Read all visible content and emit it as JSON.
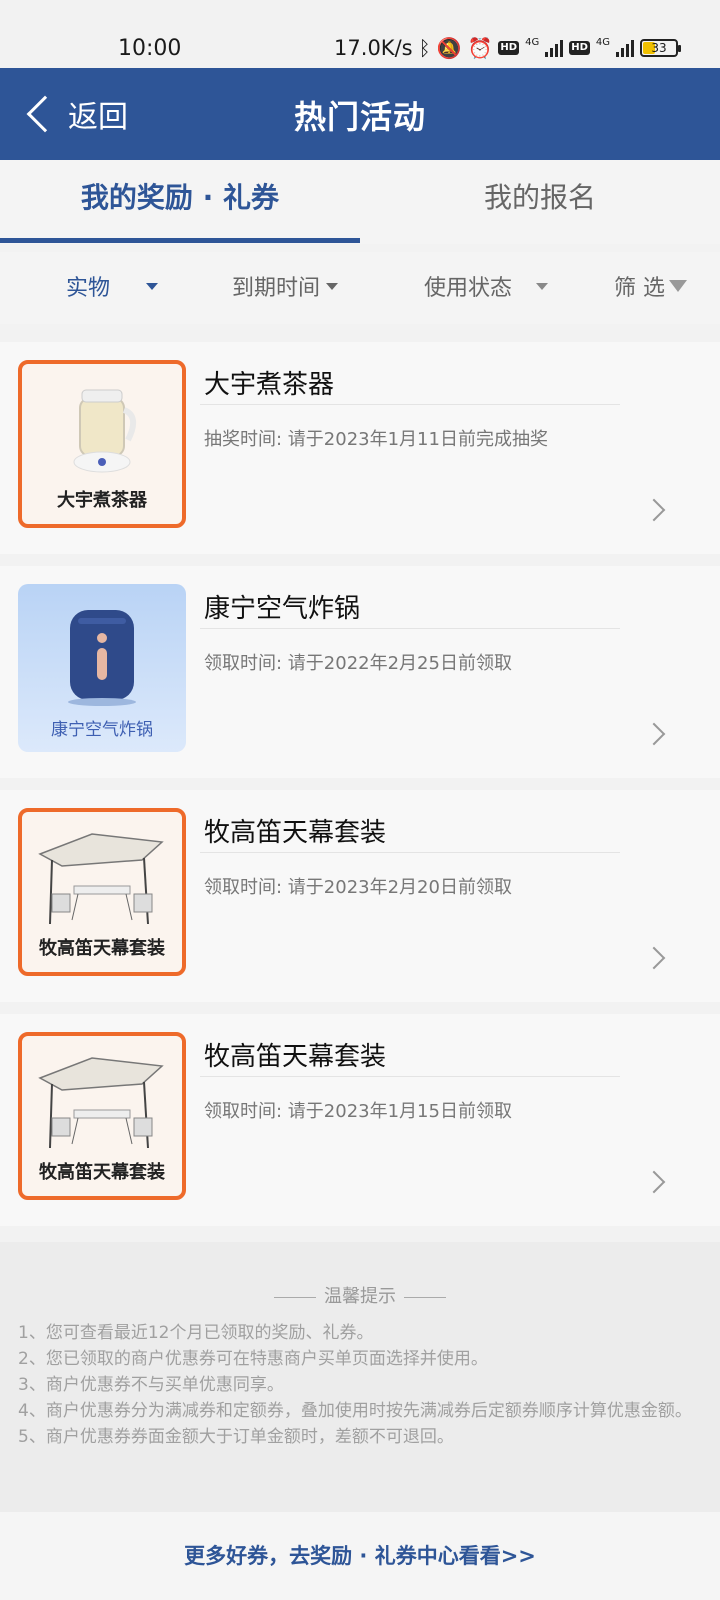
{
  "status_bar": {
    "time": "10:00",
    "speed": "17.0K/s",
    "battery": "33",
    "network1": "4G",
    "network2": "4G"
  },
  "nav": {
    "back_label": "返回",
    "title": "热门活动"
  },
  "tabs": [
    {
      "label": "我的奖励 · 礼券",
      "active": true
    },
    {
      "label": "我的报名",
      "active": false
    }
  ],
  "filters": {
    "goods": "实物",
    "expiry": "到期时间",
    "status": "使用状态",
    "screen": "筛 选"
  },
  "items": [
    {
      "title": "大宇煮茶器",
      "meta": "抽奖时间: 请于2023年1月11日前完成抽奖",
      "thumb_caption": "大宇煮茶器",
      "thumb_style": "orange",
      "thumb_icon": "tea-maker-image"
    },
    {
      "title": "康宁空气炸锅",
      "meta": "领取时间: 请于2022年2月25日前领取",
      "thumb_caption": "康宁空气炸锅",
      "thumb_style": "blue",
      "thumb_icon": "air-fryer-image"
    },
    {
      "title": "牧高笛天幕套装",
      "meta": "领取时间: 请于2023年2月20日前领取",
      "thumb_caption": "牧高笛天幕套装",
      "thumb_style": "orange",
      "thumb_icon": "canopy-image"
    },
    {
      "title": "牧高笛天幕套装",
      "meta": "领取时间: 请于2023年1月15日前领取",
      "thumb_caption": "牧高笛天幕套装",
      "thumb_style": "orange",
      "thumb_icon": "canopy-image"
    }
  ],
  "tips": {
    "heading": "温馨提示",
    "lines": [
      "1、您可查看最近12个月已领取的奖励、礼券。",
      "2、您已领取的商户优惠券可在特惠商户买单页面选择并使用。",
      "3、商户优惠券不与买单优惠同享。",
      "4、商户优惠券分为满减券和定额券，叠加使用时按先满减券后定额券顺序计算优惠金额。",
      "5、商户优惠券券面金额大于订单金额时，差额不可退回。"
    ]
  },
  "footer": {
    "link": "更多好券，去奖励 · 礼券中心看看>>"
  },
  "colors": {
    "brand": "#2e5597",
    "accent_border": "#ee6a2a"
  }
}
